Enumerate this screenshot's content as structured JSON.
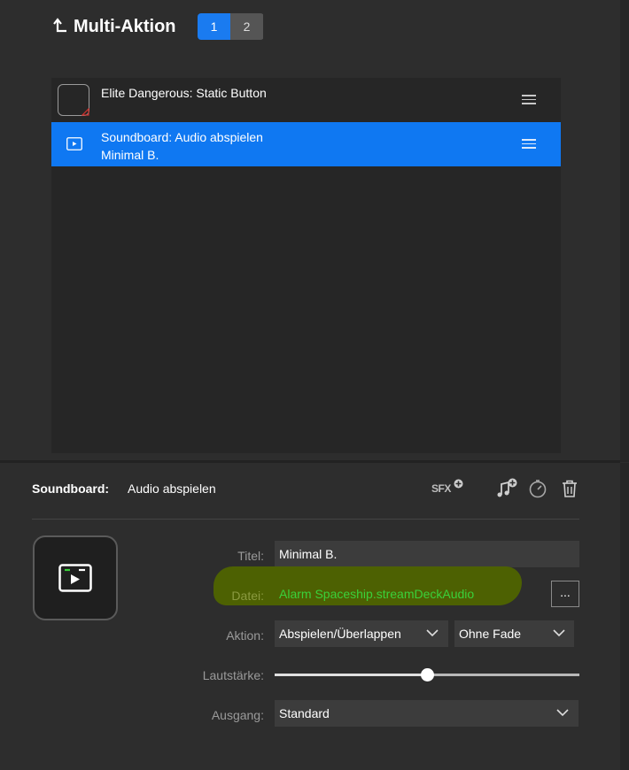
{
  "header": {
    "title": "Multi-Aktion",
    "pages": [
      "1",
      "2"
    ],
    "active_page": "1"
  },
  "actions": [
    {
      "label_line1": "Elite Dangerous: Static Button",
      "label_line2": "",
      "selected": false,
      "icon": "blank-key-icon"
    },
    {
      "label_line1": "Soundboard: Audio abspielen",
      "label_line2": "Minimal B.",
      "selected": true,
      "icon": "soundboard-play-icon"
    }
  ],
  "inspector": {
    "plugin_label": "Soundboard:",
    "action_label": "Audio abspielen",
    "toolbar": {
      "sfx_label": "SFX",
      "icons": [
        "sfx-add-icon",
        "music-add-icon",
        "timer-icon",
        "trash-icon"
      ]
    },
    "titel_label": "Titel:",
    "titel_value": "Minimal B.",
    "datei_label": "Datei:",
    "datei_value": "Alarm Spaceship.streamDeckAudio",
    "browse_label": "...",
    "aktion_label": "Aktion:",
    "aktion_value": "Abspielen/Überlappen",
    "fade_value": "Ohne Fade",
    "lautstaerke_label": "Lautstärke:",
    "volume_fraction": 0.5,
    "ausgang_label": "Ausgang:",
    "ausgang_value": "Standard"
  },
  "colors": {
    "accent": "#0f78f2",
    "file_text": "#3ad13a",
    "highlight": "#4f6400"
  }
}
